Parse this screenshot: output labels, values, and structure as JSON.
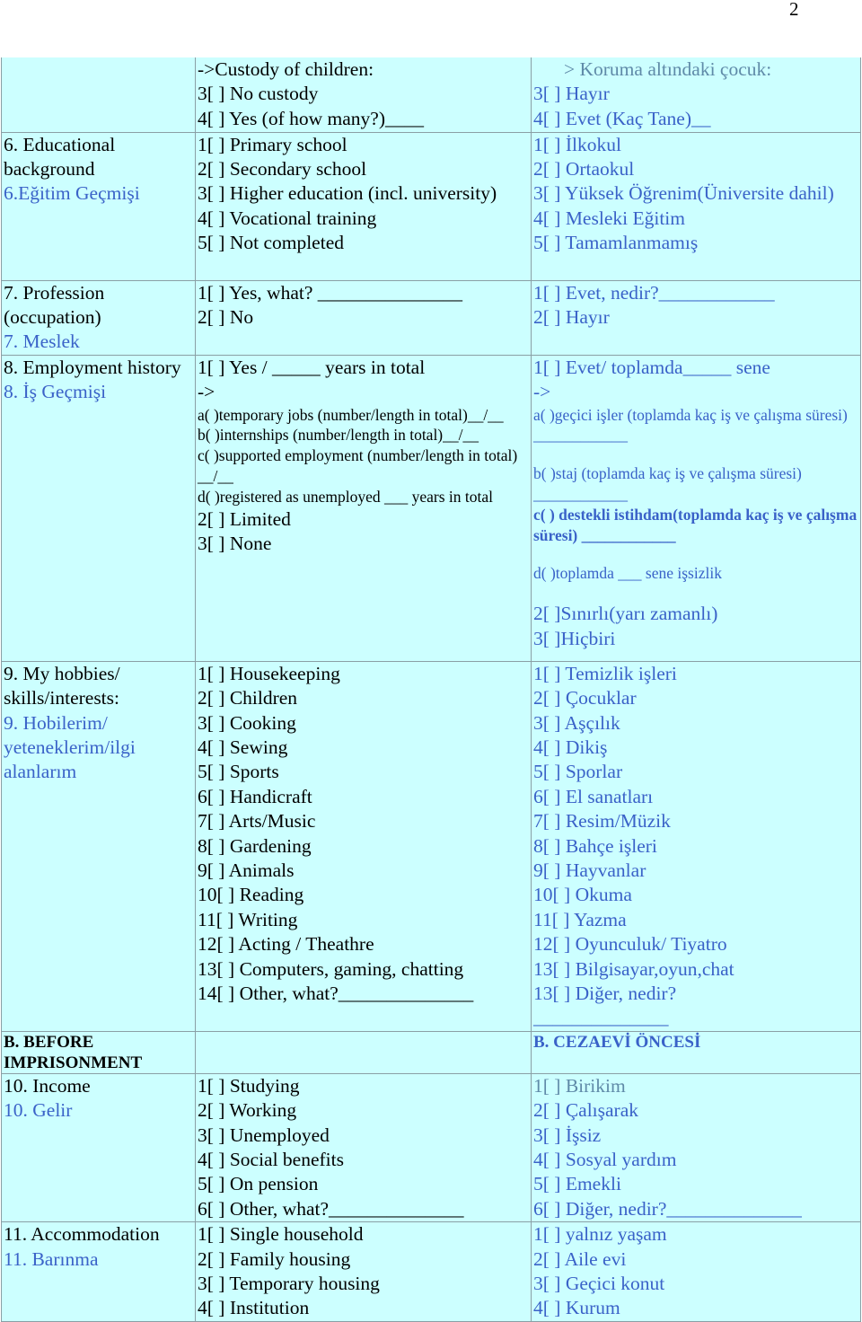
{
  "page_number": "2",
  "rows": [
    {
      "id": "custody",
      "label_en": "",
      "label_tr": "",
      "options_en": [
        "->Custody of children:",
        "3[ ] No custody",
        "4[ ] Yes (of how many?)____"
      ],
      "options_tr": [
        ">   Koruma altındaki çocuk:",
        "3[ ] Hayır",
        "4[ ] Evet (Kaç Tane)__"
      ]
    },
    {
      "id": "education",
      "label_en": "6. Educational background",
      "label_tr": "6.Eğitim Geçmişi",
      "options_en": [
        "1[ ] Primary school",
        "2[ ] Secondary school",
        "3[ ] Higher education (incl. university)",
        "4[ ] Vocational training",
        "5[ ] Not completed"
      ],
      "options_tr": [
        "1[ ] İlkokul",
        "2[ ] Ortaokul",
        "3[ ] Yüksek Öğrenim(Üniversite dahil)",
        "4[ ] Mesleki Eğitim",
        "5[ ] Tamamlanmamış"
      ]
    },
    {
      "id": "profession",
      "label_en": "7. Profession (occupation)",
      "label_tr": "7. Meslek",
      "options_en": [
        "1[ ] Yes, what? _______________",
        "2[ ] No"
      ],
      "options_tr": [
        "1[ ] Evet, nedir?____________",
        "2[ ] Hayır"
      ]
    },
    {
      "id": "employment",
      "label_en": "8. Employment history",
      "label_tr": "8. İş Geçmişi",
      "options_en": {
        "yes": "1[ ] Yes / _____ years in total",
        "arrow": "->",
        "sub": [
          "a( )temporary jobs (number/length in total)__/__",
          "b( )internships (number/length in total)__/__",
          "c( )supported employment (number/length in total) __/__",
          "d( )registered as unemployed ___ years in total"
        ],
        "limited": "2[ ] Limited",
        "none": "3[ ] None"
      },
      "options_tr": {
        "yes": "1[ ] Evet/ toplamda_____ sene",
        "arrow": "->",
        "sub": [
          "a( )geçici işler (toplamda kaç iş ve çalışma süresi) ____________",
          "b( )staj (toplamda kaç iş ve çalışma süresi) ____________",
          "c( ) destekli istihdam(toplamda kaç iş ve çalışma süresi) ____________",
          "d( )toplamda ___  sene işsizlik"
        ],
        "limited": "2[ ]Sınırlı(yarı zamanlı)",
        "none": "3[ ]Hiçbiri"
      }
    },
    {
      "id": "hobbies",
      "label_en": "9. My hobbies/ skills/interests:",
      "label_tr": "9. Hobilerim/ yeteneklerim/ilgi alanlarım",
      "options_en": [
        "1[ ] Housekeeping",
        "2[ ] Children",
        "3[ ] Cooking",
        "4[ ] Sewing",
        "5[ ] Sports",
        "6[ ] Handicraft",
        "7[ ] Arts/Music",
        "8[ ] Gardening",
        "9[ ] Animals",
        "10[ ] Reading",
        "11[ ] Writing",
        "12[ ] Acting / Theathre",
        "13[ ] Computers, gaming, chatting",
        "14[ ] Other, what?______________"
      ],
      "options_tr": [
        "1[ ] Temizlik işleri",
        "2[ ] Çocuklar",
        "3[ ] Aşçılık",
        "4[ ] Dikiş",
        "5[ ] Sporlar",
        "6[ ] El sanatları",
        "7[ ] Resim/Müzik",
        "8[ ] Bahçe işleri",
        "9[ ] Hayvanlar",
        "10[ ] Okuma",
        "11[ ] Yazma",
        "12[ ] Oyunculuk/ Tiyatro",
        "13[ ] Bilgisayar,oyun,chat",
        "13[ ] Diğer, nedir?______________"
      ]
    },
    {
      "id": "section-b",
      "label_en": "B. BEFORE IMPRISONMENT",
      "label_tr": "B. CEZAEVİ ÖNCESİ"
    },
    {
      "id": "income",
      "label_en": "10. Income",
      "label_tr": "10. Gelir",
      "options_en": [
        "1[ ] Studying",
        "2[ ] Working",
        "3[ ] Unemployed",
        "4[ ] Social benefits",
        "5[ ] On pension",
        "6[ ] Other, what?______________"
      ],
      "options_tr": [
        "1[ ] Birikim",
        "2[ ] Çalışarak",
        "3[ ] İşsiz",
        "4[ ] Sosyal yardım",
        "5[ ] Emekli",
        "6[ ] Diğer, nedir?______________"
      ]
    },
    {
      "id": "accommodation",
      "label_en": "11. Accommodation",
      "label_tr": "11. Barınma",
      "options_en": [
        "1[ ] Single household",
        "2[ ] Family housing",
        "3[ ] Temporary housing",
        "4[ ] Institution"
      ],
      "options_tr": [
        "1[ ] yalnız yaşam",
        "2[ ] Aile evi",
        "3[ ] Geçici konut",
        "4[ ] Kurum"
      ]
    }
  ]
}
